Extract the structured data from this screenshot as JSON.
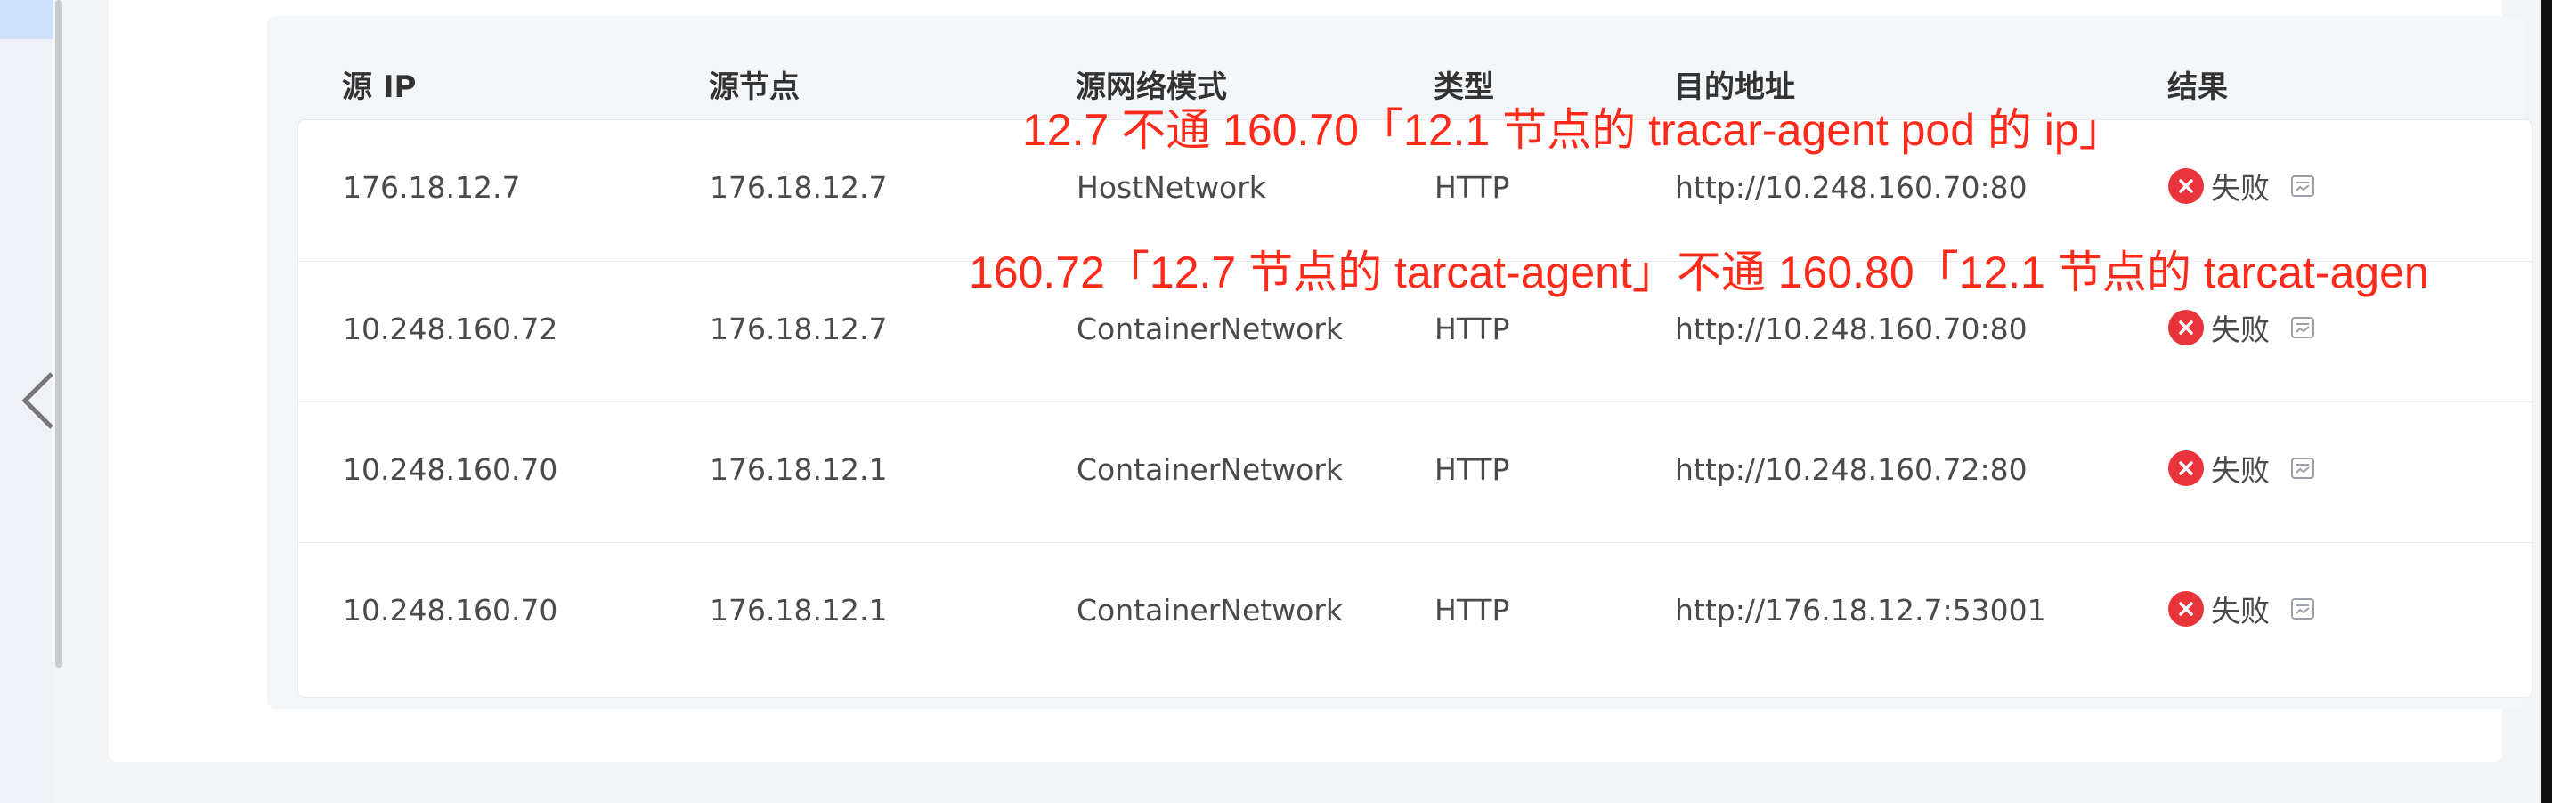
{
  "table": {
    "headers": [
      "源 IP",
      "源节点",
      "源网络模式",
      "类型",
      "目的地址",
      "结果"
    ],
    "rows": [
      {
        "src_ip": "176.18.12.7",
        "src_node": "176.18.12.7",
        "mode": "HostNetwork",
        "type": "HTTP",
        "dest": "http://10.248.160.70:80",
        "result": "失败"
      },
      {
        "src_ip": "10.248.160.72",
        "src_node": "176.18.12.7",
        "mode": "ContainerNetwork",
        "type": "HTTP",
        "dest": "http://10.248.160.70:80",
        "result": "失败"
      },
      {
        "src_ip": "10.248.160.70",
        "src_node": "176.18.12.1",
        "mode": "ContainerNetwork",
        "type": "HTTP",
        "dest": "http://10.248.160.72:80",
        "result": "失败"
      },
      {
        "src_ip": "10.248.160.70",
        "src_node": "176.18.12.1",
        "mode": "ContainerNetwork",
        "type": "HTTP",
        "dest": "http://176.18.12.7:53001",
        "result": "失败"
      }
    ]
  },
  "annotations": {
    "line1": "12.7 不通 160.70「12.1 节点的 tracar-agent pod 的 ip」",
    "line2": "160.72「12.7 节点的 tarcat-agent」不通 160.80「12.1 节点的 tarcat-agen"
  },
  "colors": {
    "fail": "#e8343a",
    "annotation": "#ff2a1a"
  },
  "icons": {
    "prev": "chevron-left-icon",
    "next": "chevron-right-icon",
    "fail": "close-circle-icon",
    "detail": "document-icon"
  }
}
